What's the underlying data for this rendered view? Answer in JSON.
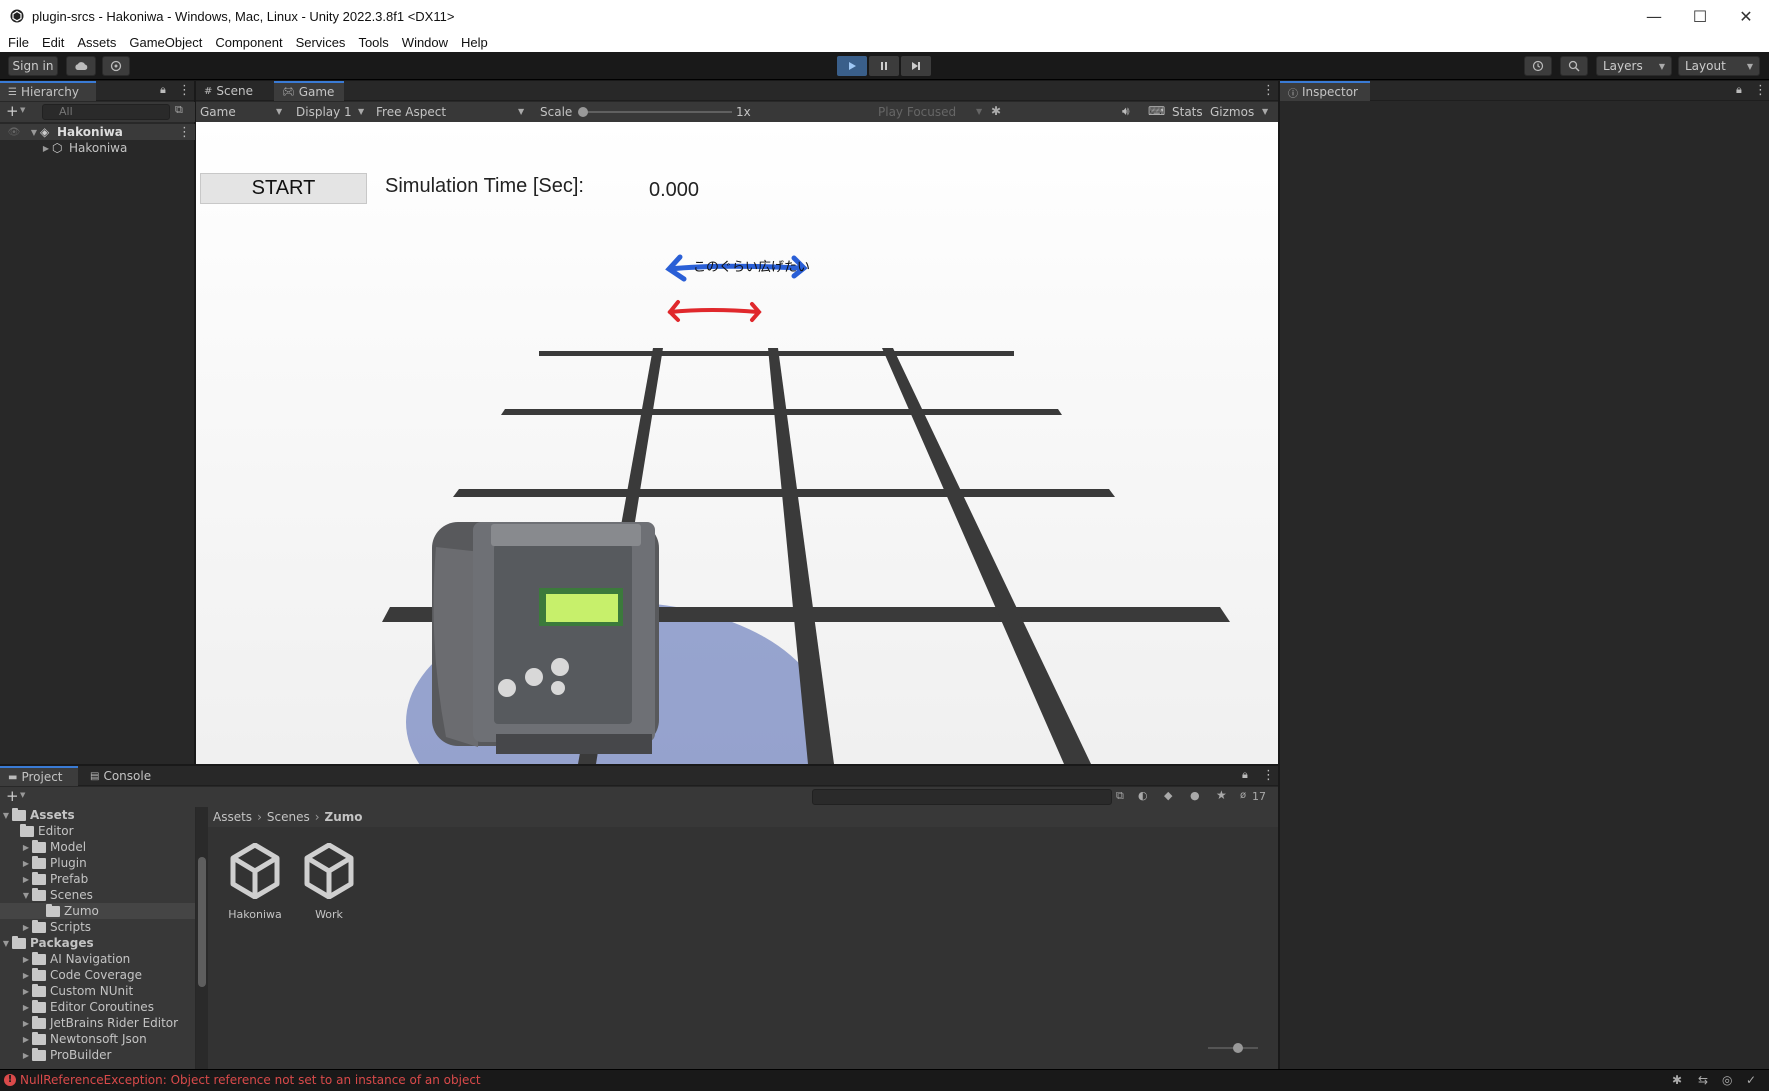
{
  "window": {
    "title": "plugin-srcs - Hakoniwa - Windows, Mac, Linux - Unity 2022.3.8f1 <DX11>",
    "controls": [
      "—",
      "☐",
      "✕"
    ]
  },
  "menu": [
    "File",
    "Edit",
    "Assets",
    "GameObject",
    "Component",
    "Services",
    "Tools",
    "Window",
    "Help"
  ],
  "toolbar": {
    "sign_in": "Sign in",
    "layers": "Layers",
    "layout": "Layout"
  },
  "hierarchy": {
    "tab": "Hierarchy",
    "search_placeholder": "All",
    "items": [
      {
        "label": "Hakoniwa",
        "level": 0,
        "expanded": true
      },
      {
        "label": "Hakoniwa",
        "level": 1,
        "expanded": false
      }
    ]
  },
  "game_panel": {
    "tabs": [
      "Scene",
      "Game"
    ],
    "active_tab": "Game",
    "view_mode": "Game",
    "display": "Display 1",
    "aspect": "Free Aspect",
    "scale_label": "Scale",
    "scale_value": "1x",
    "play_mode": "Play Focused",
    "stats": "Stats",
    "gizmos": "Gizmos"
  },
  "game_view": {
    "start_button": "START",
    "sim_time_label": "Simulation Time [Sec]:",
    "sim_time_value": "0.000",
    "annotation": "このぐらい広げたい"
  },
  "inspector": {
    "tab": "Inspector"
  },
  "project": {
    "tabs": [
      "Project",
      "Console"
    ],
    "active_tab": "Project",
    "hidden_count": "17",
    "breadcrumb": [
      "Assets",
      "Scenes",
      "Zumo"
    ],
    "tree": [
      {
        "label": "Assets",
        "level": 0,
        "expanded": true,
        "bold": true
      },
      {
        "label": "Editor",
        "level": 1
      },
      {
        "label": "Model",
        "level": 1
      },
      {
        "label": "Plugin",
        "level": 1
      },
      {
        "label": "Prefab",
        "level": 1
      },
      {
        "label": "Scenes",
        "level": 1,
        "expanded": true
      },
      {
        "label": "Zumo",
        "level": 2,
        "selected": true
      },
      {
        "label": "Scripts",
        "level": 1
      },
      {
        "label": "Packages",
        "level": 0,
        "expanded": true,
        "bold": true
      },
      {
        "label": "AI Navigation",
        "level": 1
      },
      {
        "label": "Code Coverage",
        "level": 1
      },
      {
        "label": "Custom NUnit",
        "level": 1
      },
      {
        "label": "Editor Coroutines",
        "level": 1
      },
      {
        "label": "JetBrains Rider Editor",
        "level": 1
      },
      {
        "label": "Newtonsoft Json",
        "level": 1
      },
      {
        "label": "ProBuilder",
        "level": 1
      }
    ],
    "assets": [
      {
        "label": "Hakoniwa",
        "icon": "unity-scene-icon"
      },
      {
        "label": "Work",
        "icon": "unity-scene-icon"
      }
    ]
  },
  "status": {
    "message": "NullReferenceException: Object reference not set to an instance of an object",
    "color": "#d94a4a"
  }
}
